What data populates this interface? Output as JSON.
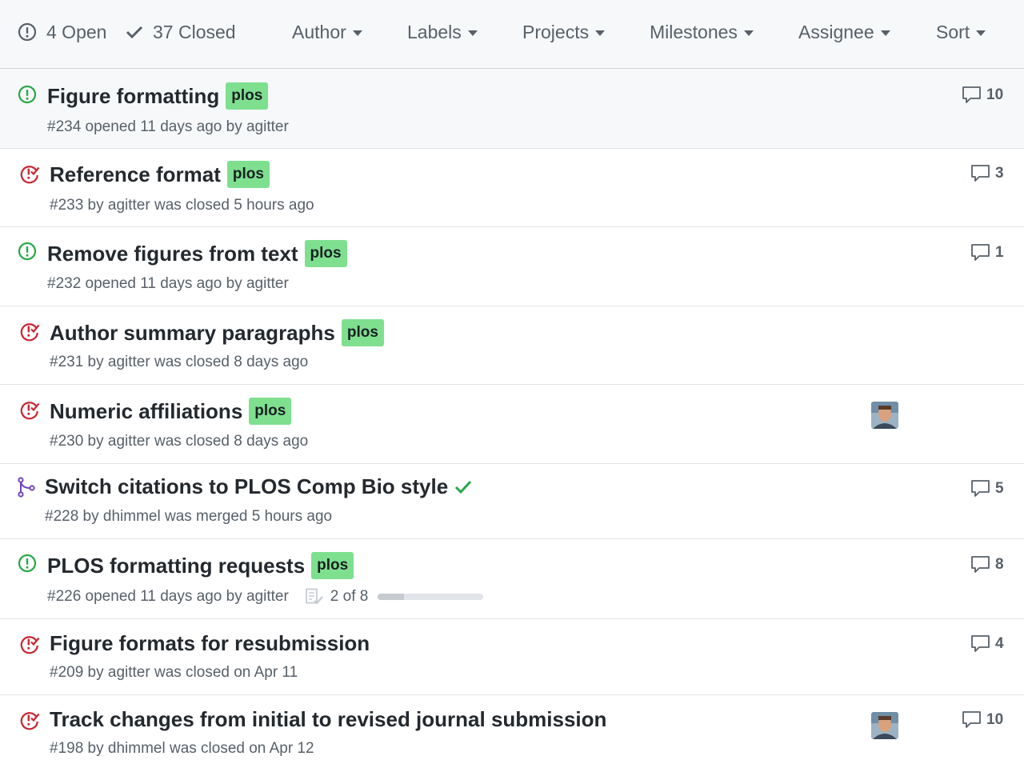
{
  "header": {
    "open_label": "4 Open",
    "closed_label": "37 Closed",
    "filters": {
      "author": "Author",
      "labels": "Labels",
      "projects": "Projects",
      "milestones": "Milestones",
      "assignee": "Assignee",
      "sort": "Sort"
    }
  },
  "colors": {
    "open": "#28a745",
    "closed": "#cb2431",
    "merged": "#6f42c1",
    "label_plos": "#7ee08f"
  },
  "issues": [
    {
      "title": "Figure formatting",
      "label": "plos",
      "meta": "#234 opened 11 days ago by agitter",
      "comments": "10",
      "state_icon": "issue-opened-icon"
    },
    {
      "title": "Reference format",
      "label": "plos",
      "meta": "#233 by agitter was closed 5 hours ago",
      "comments": "3",
      "state_icon": "issue-closed-icon"
    },
    {
      "title": "Remove figures from text",
      "label": "plos",
      "meta": "#232 opened 11 days ago by agitter",
      "comments": "1",
      "state_icon": "issue-opened-icon"
    },
    {
      "title": "Author summary paragraphs",
      "label": "plos",
      "meta": "#231 by agitter was closed 8 days ago",
      "state_icon": "issue-closed-icon"
    },
    {
      "title": "Numeric affiliations",
      "label": "plos",
      "meta": "#230 by agitter was closed 8 days ago",
      "state_icon": "issue-closed-icon"
    },
    {
      "title": "Switch citations to PLOS Comp Bio style",
      "meta": "#228 by dhimmel was merged 5 hours ago",
      "comments": "5",
      "state_icon": "merge-icon"
    },
    {
      "title": "PLOS formatting requests",
      "label": "plos",
      "meta": "#226 opened 11 days ago by agitter",
      "tasks": "2 of 8",
      "tasks_progress": 0.25,
      "comments": "8",
      "state_icon": "issue-opened-icon"
    },
    {
      "title": "Figure formats for resubmission",
      "meta": "#209 by agitter was closed on Apr 11",
      "comments": "4",
      "state_icon": "issue-closed-icon"
    },
    {
      "title": "Track changes from initial to revised journal submission",
      "meta": "#198 by dhimmel was closed on Apr 12",
      "comments": "10",
      "state_icon": "issue-closed-icon"
    }
  ]
}
